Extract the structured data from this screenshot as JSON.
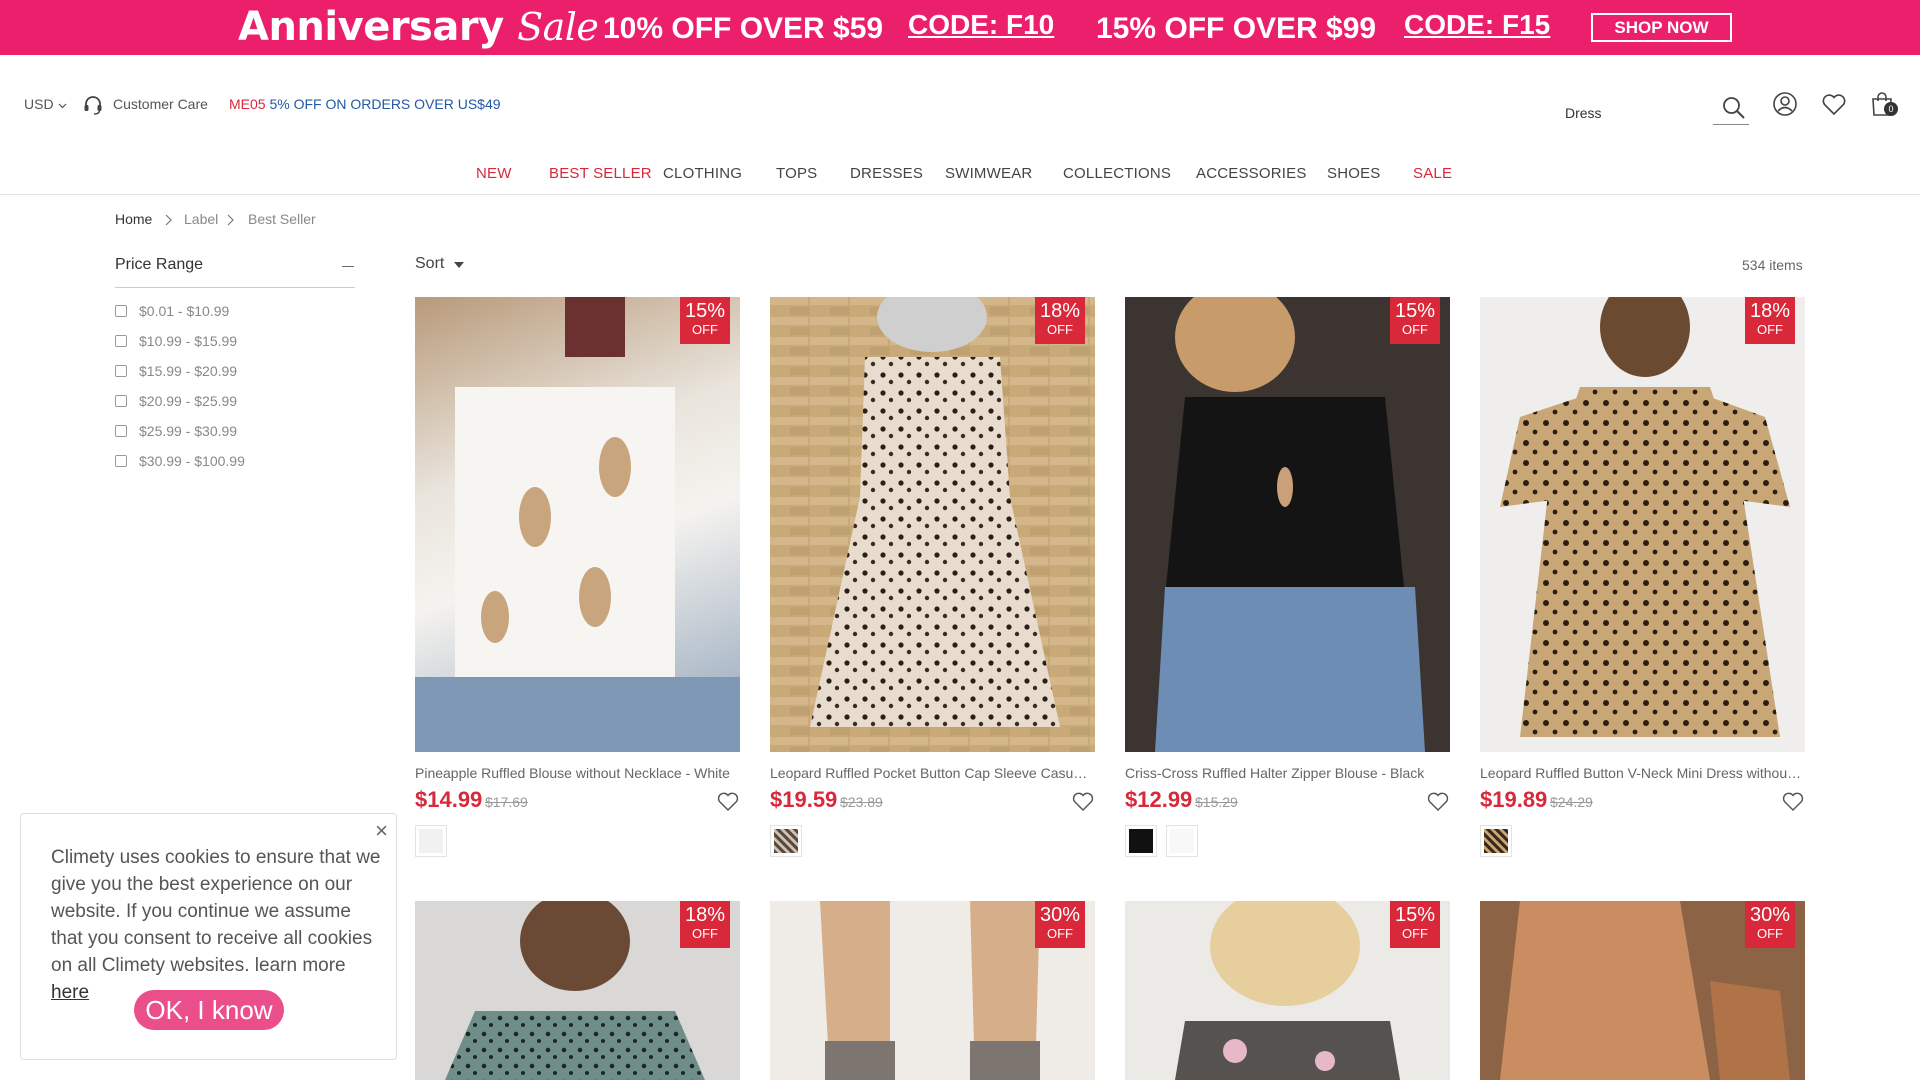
{
  "banner": {
    "brand_main": "Anniversary",
    "brand_script": "Sale",
    "deal1": "10% OFF OVER $59",
    "code1": "CODE: F10",
    "deal2": "15% OFF OVER $99",
    "code2": "CODE: F15",
    "shop_now": "SHOP NOW"
  },
  "header": {
    "currency": "USD",
    "customer_care": "Customer Care",
    "promo_code": "ME05",
    "promo_text": "5% OFF ON ORDERS OVER US$49",
    "search_value": "Dress",
    "cart_count": "0"
  },
  "nav": [
    "NEW",
    "BEST SELLER",
    "CLOTHING",
    "TOPS",
    "DRESSES",
    "SWIMWEAR",
    "COLLECTIONS",
    "ACCESSORIES",
    "SHOES",
    "SALE"
  ],
  "breadcrumb": [
    "Home",
    "Label",
    "Best Seller"
  ],
  "filter": {
    "title": "Price Range",
    "ranges": [
      "$0.01 - $10.99",
      "$10.99 - $15.99",
      "$15.99 - $20.99",
      "$20.99 - $25.99",
      "$25.99 - $30.99",
      "$30.99 - $100.99"
    ]
  },
  "listing": {
    "sort_label": "Sort",
    "count": "534 items"
  },
  "products": [
    {
      "name": "Pineapple Ruffled Blouse without Necklace - White",
      "price": "$14.99",
      "orig": "$17.69",
      "pct": "15%",
      "off": "OFF"
    },
    {
      "name": "Leopard Ruffled Pocket Button Cap Sleeve Casual Dress",
      "price": "$19.59",
      "orig": "$23.89",
      "pct": "18%",
      "off": "OFF"
    },
    {
      "name": "Criss-Cross Ruffled Halter Zipper Blouse - Black",
      "price": "$12.99",
      "orig": "$15.29",
      "pct": "15%",
      "off": "OFF"
    },
    {
      "name": "Leopard Ruffled Button V-Neck Mini Dress without Necklace",
      "price": "$19.89",
      "orig": "$24.29",
      "pct": "18%",
      "off": "OFF"
    },
    {
      "pct": "18%",
      "off": "OFF"
    },
    {
      "pct": "30%",
      "off": "OFF"
    },
    {
      "pct": "15%",
      "off": "OFF"
    },
    {
      "pct": "30%",
      "off": "OFF"
    }
  ],
  "cookie": {
    "text": "Climety uses cookies to ensure that we give you the best experience on our website. If you continue we assume that you consent to receive all cookies on all Climety websites. learn more",
    "link": "here",
    "button": "OK, I know",
    "close": "×"
  },
  "colors": {
    "brand_pink": "#ec1f6d",
    "sale_red": "#d8283a",
    "promo_blue": "#2259a8"
  }
}
